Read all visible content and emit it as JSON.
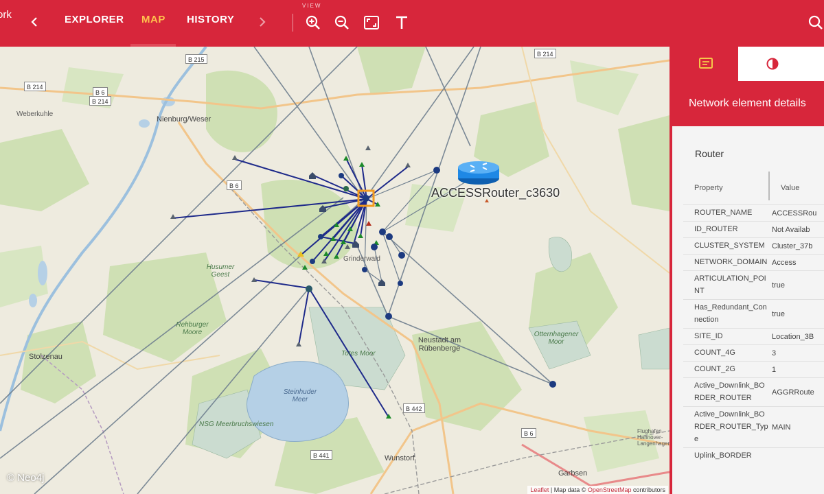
{
  "app": {
    "title_fragment": "ork"
  },
  "nav": {
    "tabs": [
      {
        "label": "EXPLORER",
        "active": false
      },
      {
        "label": "MAP",
        "active": true
      },
      {
        "label": "HISTORY",
        "active": false
      }
    ],
    "view_label": "VIEW"
  },
  "toolbar": {
    "icons": [
      "zoom-in-icon",
      "zoom-out-icon",
      "fit-screen-icon",
      "text-icon"
    ],
    "search_icon": "search-icon"
  },
  "map": {
    "places": [
      "Nienburg/Weser",
      "Stolzenau",
      "Neustadt am Rübenberge",
      "Wunstorf",
      "Garbsen",
      "Husumer Geest",
      "Rehburger Moore",
      "Totes Moor",
      "Steinhuder Meer",
      "NSG Meerbruchswiesen",
      "Grinderwald",
      "Weberkuhle",
      "Otternhagener Moor",
      "Flughafen Hannover-Langenhagen"
    ],
    "roads": [
      "B 215",
      "B 214",
      "B 6",
      "B 214",
      "B 214",
      "B 6",
      "B 442",
      "B 441",
      "B 6"
    ],
    "selected_node_label": "ACCESSRouter_c3630",
    "attribution": {
      "leaflet": "Leaflet",
      "mid": " | Map data © ",
      "osm": "OpenStreetMap",
      "tail": " contributors"
    },
    "watermark": "© Neo4j"
  },
  "panel": {
    "header_title": "Network element details",
    "section_title": "Router",
    "columns": {
      "property": "Property",
      "value": "Value"
    },
    "rows": [
      {
        "k": "ROUTER_NAME",
        "v": "ACCESSRou"
      },
      {
        "k": "ID_ROUTER",
        "v": "Not Availab"
      },
      {
        "k": "CLUSTER_SYSTEM",
        "v": "Cluster_37b"
      },
      {
        "k": "NETWORK_DOMAIN",
        "v": "Access"
      },
      {
        "k": "ARTICULATION_POINT",
        "v": "true"
      },
      {
        "k": "Has_Redundant_Connection",
        "v": "true"
      },
      {
        "k": "SITE_ID",
        "v": "Location_3B"
      },
      {
        "k": "COUNT_4G",
        "v": "3"
      },
      {
        "k": "COUNT_2G",
        "v": "1"
      },
      {
        "k": "Active_Downlink_BORDER_ROUTER",
        "v": "AGGRRoute"
      },
      {
        "k": "Active_Downlink_BORDER_ROUTER_Type",
        "v": "MAIN"
      },
      {
        "k": "Uplink_BORDER",
        "v": ""
      }
    ]
  },
  "colors": {
    "brand_red": "#d7263b",
    "active_tab": "#ffc04d",
    "link_line": "#1e2a8a",
    "node_blue": "#1c3a80",
    "node_green": "#1d8a2a"
  }
}
